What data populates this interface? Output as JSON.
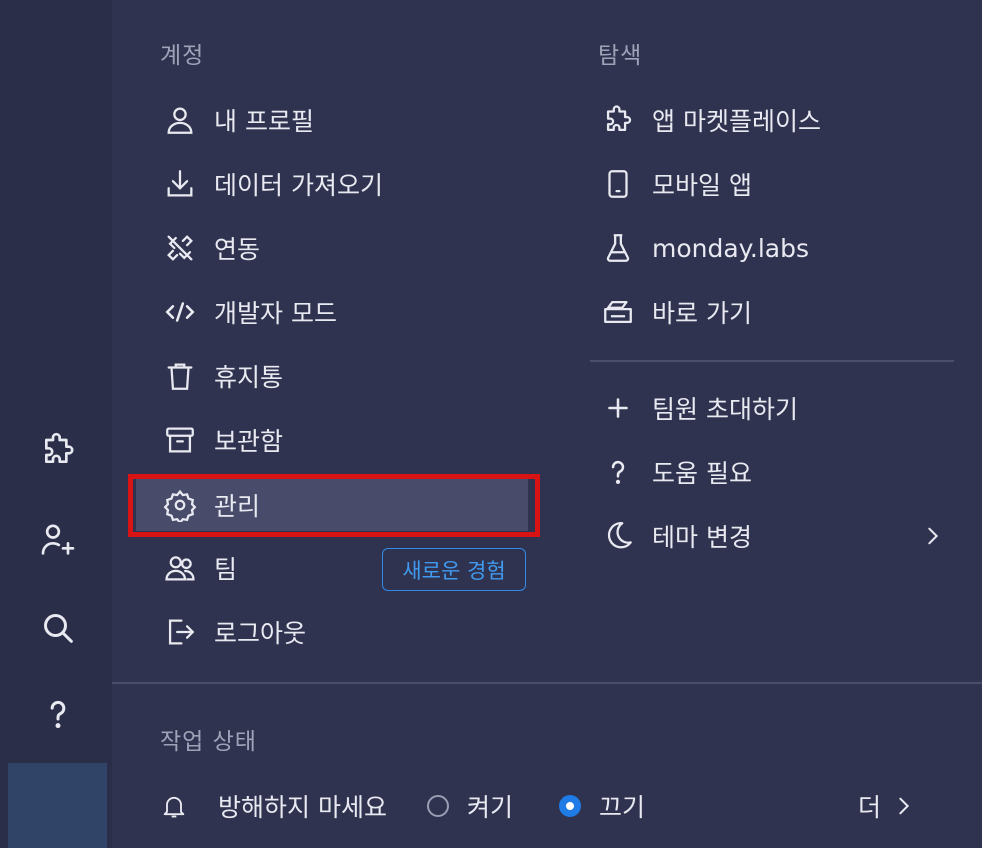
{
  "account": {
    "title": "계정",
    "items": [
      {
        "label": "내 프로필",
        "icon": "user-icon"
      },
      {
        "label": "데이터 가져오기",
        "icon": "download-icon"
      },
      {
        "label": "연동",
        "icon": "plug-off-icon"
      },
      {
        "label": "개발자 모드",
        "icon": "code-icon"
      },
      {
        "label": "휴지통",
        "icon": "trash-icon"
      },
      {
        "label": "보관함",
        "icon": "archive-icon"
      },
      {
        "label": "관리",
        "icon": "gear-icon"
      },
      {
        "label": "팀",
        "icon": "team-icon"
      },
      {
        "label": "로그아웃",
        "icon": "logout-icon"
      }
    ],
    "team_badge": "새로운 경험"
  },
  "explore": {
    "title": "탐색",
    "items": [
      {
        "label": "앱 마켓플레이스",
        "icon": "puzzle-icon"
      },
      {
        "label": "모바일 앱",
        "icon": "mobile-icon"
      },
      {
        "label": "monday.labs",
        "icon": "flask-icon"
      },
      {
        "label": "바로 가기",
        "icon": "shortcut-icon"
      }
    ],
    "extra": [
      {
        "label": "팀원 초대하기",
        "icon": "plus-icon"
      },
      {
        "label": "도움 필요",
        "icon": "question-icon"
      },
      {
        "label": "테마 변경",
        "icon": "moon-icon"
      }
    ]
  },
  "work_status": {
    "title": "작업 상태",
    "dnd_label": "방해하지 마세요",
    "on_label": "켜기",
    "off_label": "끄기",
    "selected": "끄기",
    "more_label": "더"
  },
  "rail": {
    "icons": [
      "puzzle-icon",
      "add-user-icon",
      "search-icon",
      "help-icon"
    ]
  },
  "colors": {
    "background": "#30334f",
    "rail": "#2b2e48",
    "accent": "#1f7be6",
    "selection_border": "#d81313"
  }
}
